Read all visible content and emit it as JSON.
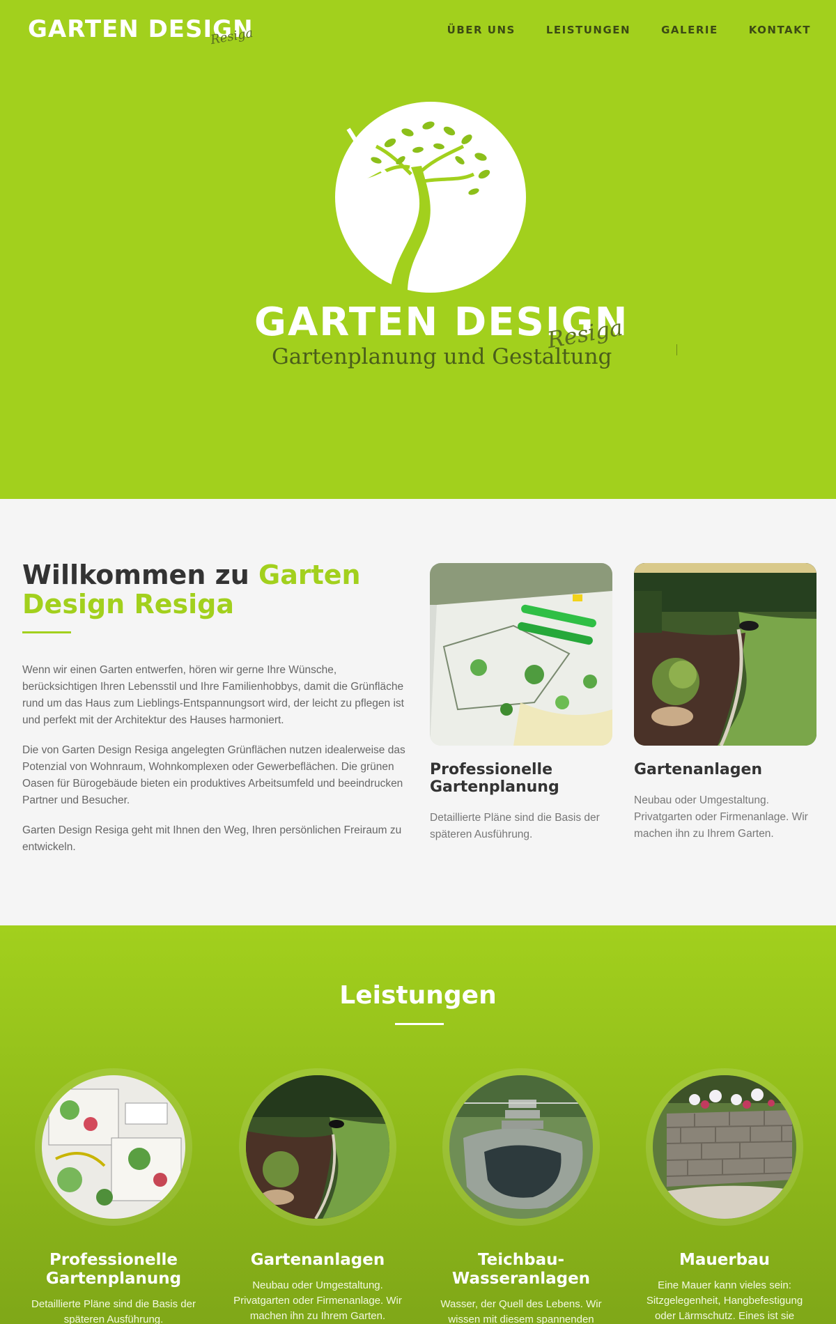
{
  "header": {
    "brand_main": "GARTEN DESIGN",
    "brand_script": "Resiga",
    "nav": [
      {
        "label": "ÜBER UNS"
      },
      {
        "label": "LEISTUNGEN"
      },
      {
        "label": "GALERIE"
      },
      {
        "label": "KONTAKT"
      }
    ]
  },
  "hero": {
    "logo_title": "GARTEN DESIGN",
    "logo_script": "Resiga",
    "logo_tagline": "Gartenplanung und Gestaltung",
    "icon": "tree-logo-icon"
  },
  "welcome": {
    "title_prefix": "Willkommen zu",
    "title_accent": "Garten Design Resiga",
    "paragraphs": [
      "Wenn wir einen Garten entwerfen, hören wir gerne Ihre Wünsche, berücksichtigen Ihren Lebensstil und Ihre Familienhobbys, damit die Grünfläche rund um das Haus zum Lieblings-Entspannungsort wird, der leicht zu pflegen ist und perfekt mit der Architektur des Hauses harmoniert.",
      "Die von Garten Design Resiga angelegten Grünflächen nutzen idealerweise das Potenzial von Wohnraum, Wohnkomplexen oder Gewerbeflächen. Die grünen Oasen für Bürogebäude bieten ein produktives Arbeitsumfeld und beeindrucken Partner und Besucher.",
      "Garten Design Resiga geht mit Ihnen den Weg, Ihren persönlichen Freiraum zu entwickeln."
    ],
    "features": [
      {
        "title": "Professionelle Gartenplanung",
        "text": "Detaillierte Pläne sind die Basis der späteren Ausführung."
      },
      {
        "title": "Gartenanlagen",
        "text": "Neubau oder Umgestaltung. Privatgarten oder Firmenanlage. Wir machen ihn zu Ihrem Garten."
      }
    ]
  },
  "services": {
    "title": "Leistungen",
    "items": [
      {
        "title": "Professionelle Gartenplanung",
        "text": "Detaillierte Pläne sind die Basis der späteren Ausführung."
      },
      {
        "title": "Gartenanlagen",
        "text": "Neubau oder Umgestaltung. Privatgarten oder Firmenanlage. Wir machen ihn zu Ihrem Garten."
      },
      {
        "title": "Teichbau-Wasseranlagen",
        "text": "Wasser, der Quell des Lebens. Wir wissen mit diesem spannenden Element umzugehen."
      },
      {
        "title": "Mauerbau",
        "text": "Eine Mauer kann vieles sein: Sitzgelegenheit, Hangbefestigung oder Lärmschutz. Eines ist sie immer: ein von Hand erschaffenes"
      }
    ]
  },
  "colors": {
    "accent": "#a2d01d",
    "dark_text": "#333333",
    "nav_text": "#3c4a14"
  }
}
